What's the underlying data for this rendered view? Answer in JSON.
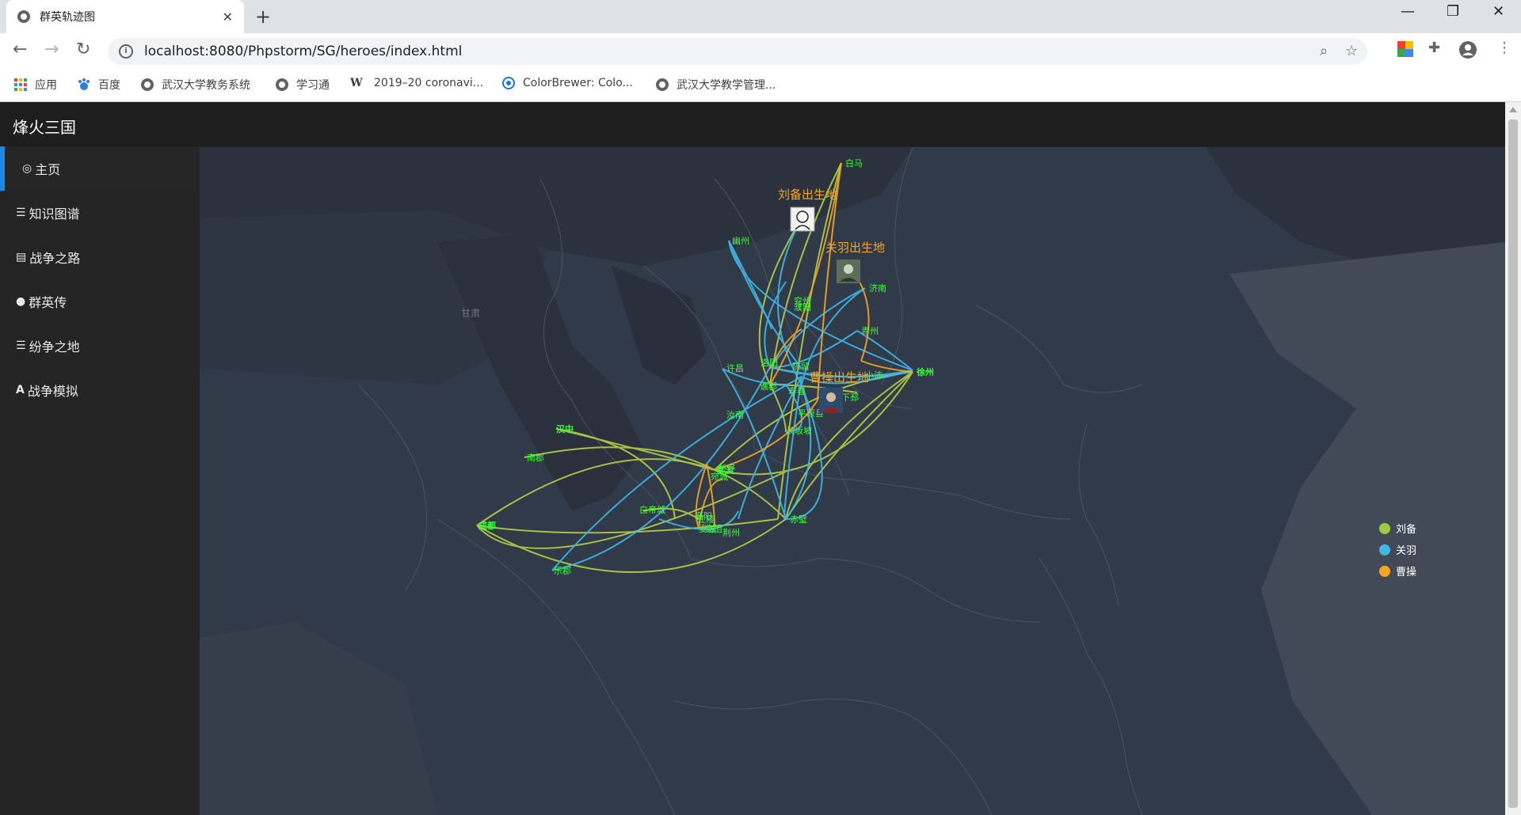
{
  "browser": {
    "tab_title": "群英轨迹图",
    "url": "localhost:8080/Phpstorm/SG/heroes/index.html",
    "bookmarks": [
      "应用",
      "百度",
      "武汉大学教务系统",
      "学习通",
      "2019–20 coronavi...",
      "ColorBrewer: Colo...",
      "武汉大学教学管理..."
    ]
  },
  "app": {
    "brand": "烽火三国",
    "menu": [
      {
        "label": "主页",
        "icon": "target-icon",
        "active": true
      },
      {
        "label": "知识图谱",
        "icon": "list-icon"
      },
      {
        "label": "战争之路",
        "icon": "table-icon"
      },
      {
        "label": "群英传",
        "icon": "globe-icon"
      },
      {
        "label": "纷争之地",
        "icon": "list-icon"
      },
      {
        "label": "战争模拟",
        "icon": "font-icon"
      }
    ]
  },
  "map": {
    "province_label": "甘肃",
    "birthplaces": [
      "刘备出生地",
      "关羽出生地",
      "曹操出生地"
    ],
    "cities": [
      "白马",
      "幽州",
      "济南",
      "青州",
      "兖州",
      "小沛",
      "徐州",
      "许昌",
      "陈留",
      "下邳",
      "谯郡",
      "汝南",
      "宛城",
      "新野",
      "襄阳",
      "长坂坡",
      "荆州",
      "赤壁",
      "江陵",
      "白帝城",
      "成都",
      "汉中",
      "南郡",
      "乐郡",
      "寿春",
      "洛阳",
      "麦城",
      "临沮",
      "平原县",
      "官渡",
      "濮阳"
    ],
    "legend": [
      {
        "name": "刘备",
        "color": "#9ccc3c"
      },
      {
        "name": "关羽",
        "color": "#3fb8e8"
      },
      {
        "name": "曹操",
        "color": "#f5a623"
      }
    ]
  }
}
